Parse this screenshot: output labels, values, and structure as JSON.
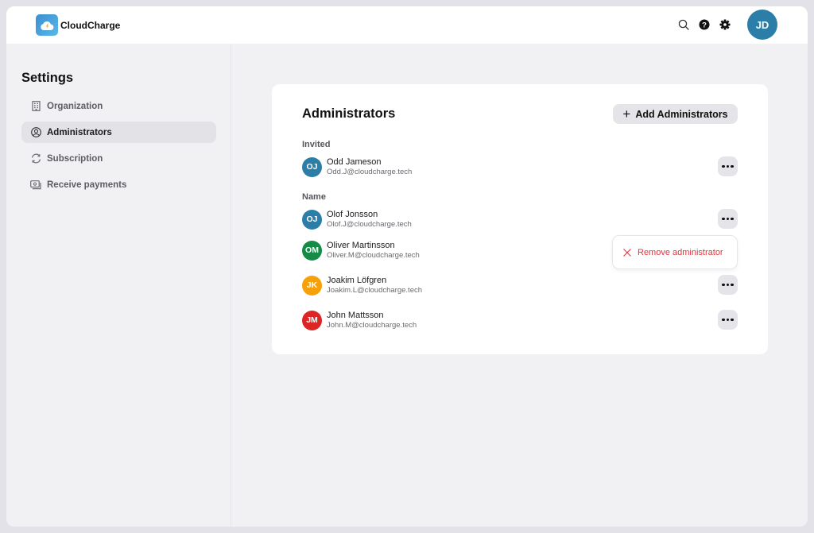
{
  "app": {
    "name": "CloudCharge",
    "user_initials": "JD",
    "colors": {
      "brand": "#3a8fd0",
      "avatar_me": "#2b7ea7",
      "danger": "#e3343d"
    }
  },
  "topbar": {
    "icons": [
      "search-icon",
      "help-icon",
      "gear-icon"
    ]
  },
  "sidebar": {
    "title": "Settings",
    "items": [
      {
        "label": "Organization",
        "icon": "building-icon",
        "active": false
      },
      {
        "label": "Administrators",
        "icon": "user-circle-icon",
        "active": true
      },
      {
        "label": "Subscription",
        "icon": "refresh-icon",
        "active": false
      },
      {
        "label": "Receive payments",
        "icon": "payment-icon",
        "active": false
      }
    ]
  },
  "main": {
    "title": "Administrators",
    "add_button_label": "Add Administrators",
    "invited": {
      "label": "Invited",
      "people": [
        {
          "initials": "OJ",
          "name": "Odd Jameson",
          "email": "Odd.J@cloudcharge.tech",
          "color": "#2b7ea7"
        }
      ]
    },
    "members": {
      "label": "Name",
      "people": [
        {
          "initials": "OJ",
          "name": "Olof Jonsson",
          "email": "Olof.J@cloudcharge.tech",
          "color": "#2b7ea7"
        },
        {
          "initials": "OM",
          "name": "Oliver Martinsson",
          "email": "Oliver.M@cloudcharge.tech",
          "color": "#168a47"
        },
        {
          "initials": "JK",
          "name": "Joakim Löfgren",
          "email": "Joakim.L@cloudcharge.tech",
          "color": "#f7a10a"
        },
        {
          "initials": "JM",
          "name": "John Mattsson",
          "email": "John.M@cloudcharge.tech",
          "color": "#dc2626"
        }
      ]
    },
    "context_menu": {
      "items": [
        {
          "label": "Remove administrator",
          "icon": "close-icon"
        }
      ]
    }
  }
}
